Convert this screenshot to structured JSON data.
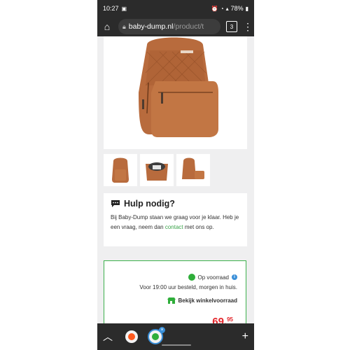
{
  "status": {
    "time": "10:27",
    "battery": "78%"
  },
  "browser": {
    "url_domain": "baby-dump.nl",
    "url_path": "/product/t",
    "tab_count": "3"
  },
  "help": {
    "title": "Hulp nodig?",
    "text_before": "Bij Baby-Dump staan we graag voor je klaar. Heb je een vraag, neem dan ",
    "link": "contact",
    "text_after": " met ons op."
  },
  "stock": {
    "status": "Op voorraad",
    "delivery": "Voor 19:00 uur besteld, morgen in huis.",
    "store_link": "Bekijk winkelvoorraad",
    "price_main": "69,",
    "price_cents": "95"
  },
  "colors": {
    "accent_green": "#3cb04c",
    "price_red": "#e3262b",
    "bag_brown": "#b86b3d"
  }
}
